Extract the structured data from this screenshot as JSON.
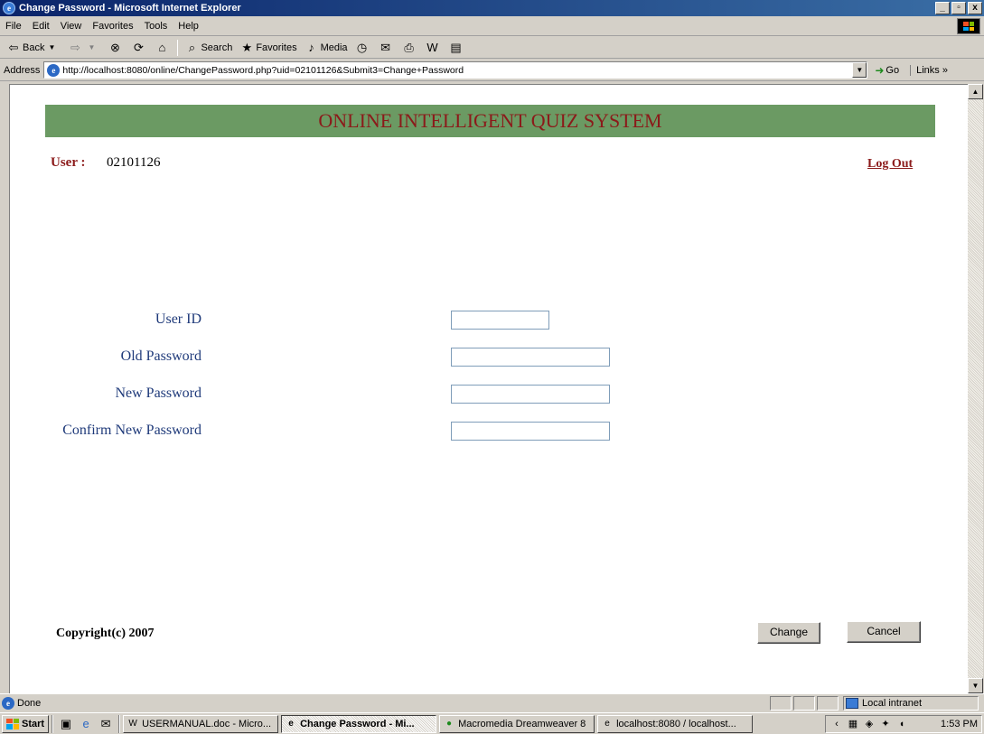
{
  "window": {
    "title": "Change Password - Microsoft Internet Explorer",
    "controls": {
      "minimize": "_",
      "restore": "▫",
      "close": "x"
    }
  },
  "menu": {
    "items": [
      "File",
      "Edit",
      "View",
      "Favorites",
      "Tools",
      "Help"
    ]
  },
  "toolbar": {
    "back": "Back",
    "search": "Search",
    "favorites": "Favorites",
    "media": "Media"
  },
  "address": {
    "label": "Address",
    "url": "http://localhost:8080/online/ChangePassword.php?uid=02101126&Submit3=Change+Password",
    "go": "Go",
    "links": "Links"
  },
  "page": {
    "banner": "ONLINE INTELLIGENT QUIZ SYSTEM",
    "user_label": "User :",
    "user_value": "02101126",
    "logout": "Log Out",
    "form": {
      "user_id_label": "User ID",
      "old_password_label": "Old Password",
      "new_password_label": "New Password",
      "confirm_password_label": "Confirm New Password",
      "user_id_value": "",
      "old_password_value": "",
      "new_password_value": "",
      "confirm_password_value": ""
    },
    "copyright": "Copyright(c) 2007",
    "change_button": "Change",
    "cancel_button": "Cancel"
  },
  "status": {
    "text": "Done",
    "zone": "Local intranet"
  },
  "taskbar": {
    "start": "Start",
    "tasks": [
      {
        "label": "USERMANUAL.doc - Micro...",
        "icon": "word-icon",
        "active": false
      },
      {
        "label": "Change Password - Mi...",
        "icon": "ie-icon",
        "active": true
      },
      {
        "label": "Macromedia Dreamweaver 8",
        "icon": "dreamweaver-icon",
        "active": false
      },
      {
        "label": "localhost:8080 / localhost...",
        "icon": "ie-icon",
        "active": false
      }
    ],
    "clock": "1:53 PM"
  },
  "colors": {
    "banner_bg": "#6b9a63",
    "banner_text": "#8b1a1a",
    "label_blue": "#1f3a7a"
  }
}
